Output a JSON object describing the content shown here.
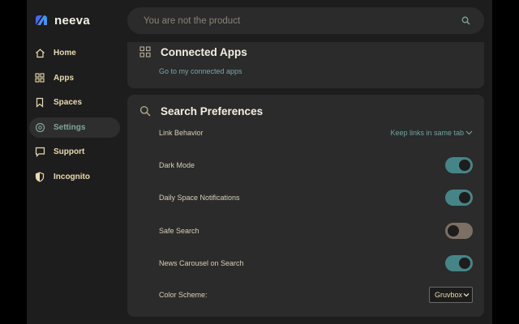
{
  "brand": {
    "name": "neeva"
  },
  "sidebar": {
    "items": [
      {
        "label": "Home",
        "icon": "home-icon"
      },
      {
        "label": "Apps",
        "icon": "apps-grid-icon"
      },
      {
        "label": "Spaces",
        "icon": "bookmark-icon"
      },
      {
        "label": "Settings",
        "icon": "settings-icon",
        "active": true
      },
      {
        "label": "Support",
        "icon": "chat-bubble-icon"
      },
      {
        "label": "Incognito",
        "icon": "shield-icon"
      }
    ]
  },
  "search": {
    "placeholder": "You are not the product"
  },
  "connected_apps": {
    "title": "Connected Apps",
    "link": "Go to my connected apps"
  },
  "search_preferences": {
    "title": "Search Preferences",
    "link_behavior": {
      "label": "Link Behavior",
      "value": "Keep links in same tab"
    },
    "dark_mode": {
      "label": "Dark Mode",
      "on": true
    },
    "daily_space_notifications": {
      "label": "Daily Space Notifications",
      "on": true
    },
    "safe_search": {
      "label": "Safe Search",
      "on": false
    },
    "news_carousel": {
      "label": "News Carousel on Search",
      "on": true
    },
    "color_scheme": {
      "label": "Color Scheme:",
      "value": "Gruvbox"
    }
  },
  "colors": {
    "accent": "#458588",
    "link": "#83a598",
    "text": "#ebdbb2",
    "background": "#1d1d1d",
    "card": "#2b2b2b"
  }
}
